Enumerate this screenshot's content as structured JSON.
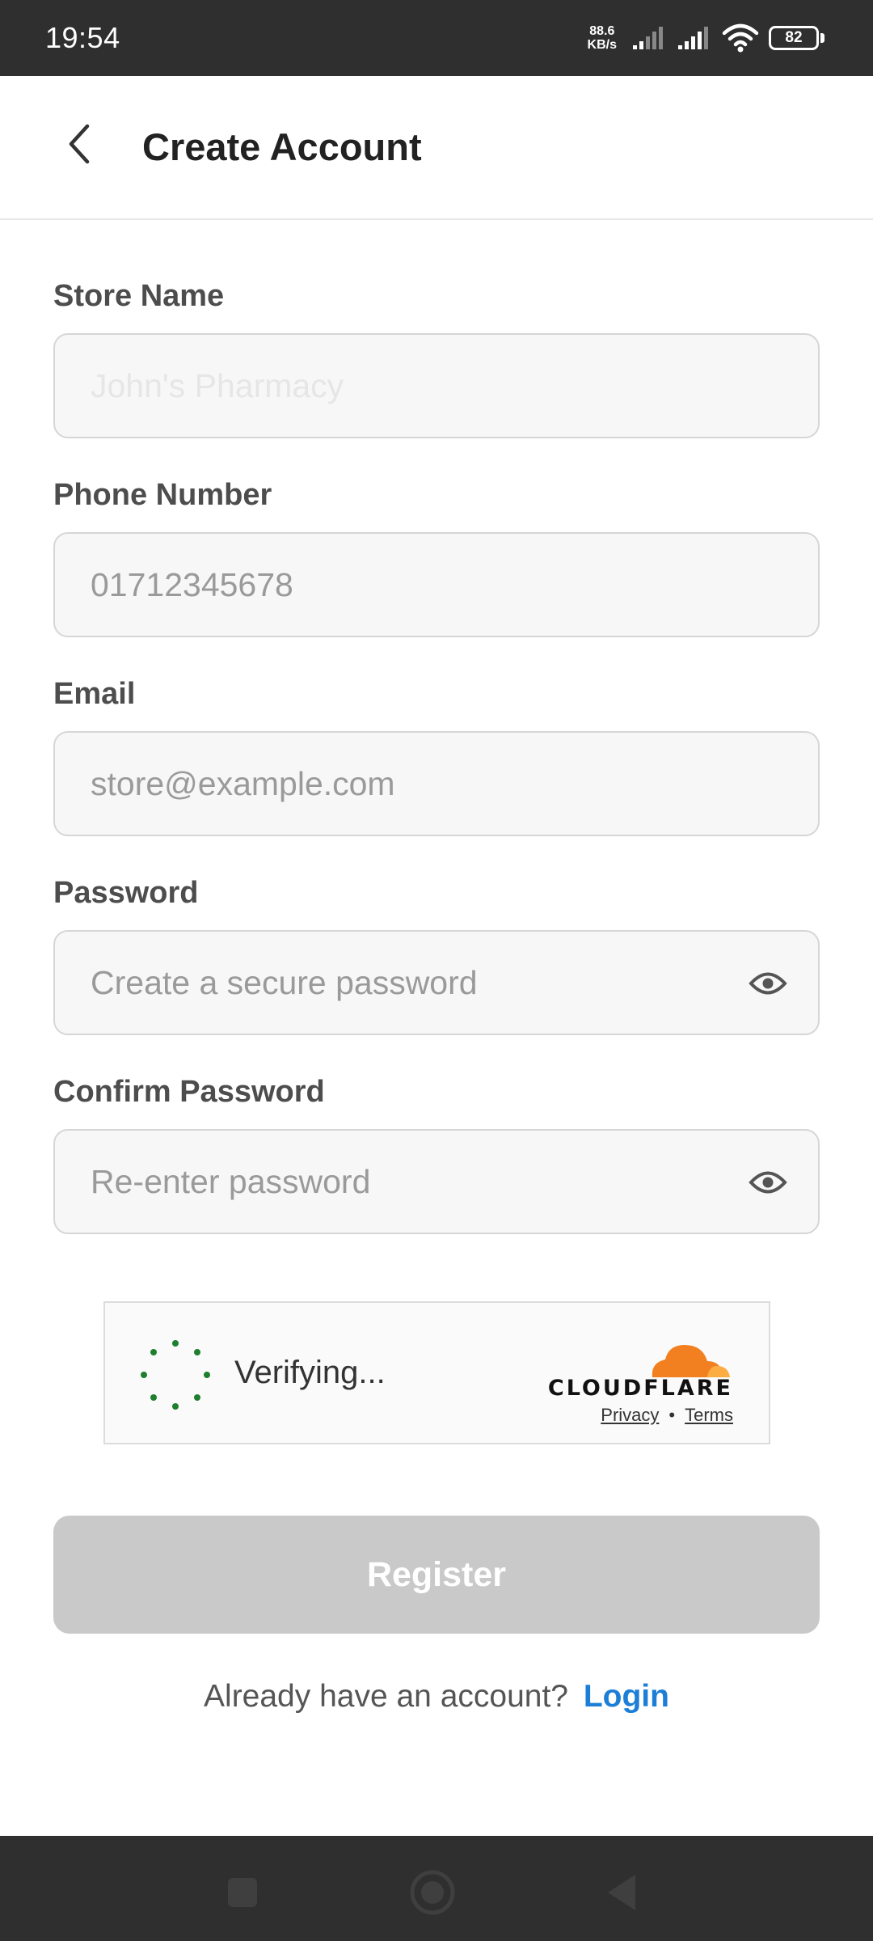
{
  "status_bar": {
    "time": "19:54",
    "net_speed_value": "88.6",
    "net_speed_unit": "KB/s",
    "battery_level": "82",
    "icons": [
      "signal-icon",
      "signal-icon",
      "wifi-icon",
      "battery-icon"
    ]
  },
  "header": {
    "title": "Create Account",
    "back_icon": "chevron-left-icon"
  },
  "form": {
    "store_name": {
      "label": "Store Name",
      "placeholder": "John's Pharmacy"
    },
    "phone": {
      "label": "Phone Number",
      "placeholder": "01712345678"
    },
    "email": {
      "label": "Email",
      "placeholder": "store@example.com"
    },
    "password": {
      "label": "Password",
      "placeholder": "Create a secure password",
      "toggle_icon": "eye-icon"
    },
    "confirm_password": {
      "label": "Confirm Password",
      "placeholder": "Re-enter password",
      "toggle_icon": "eye-icon"
    }
  },
  "captcha": {
    "status": "Verifying...",
    "brand": "CLOUDFLARE",
    "privacy_label": "Privacy",
    "separator": "•",
    "terms_label": "Terms",
    "spinner_color": "#1e7f2e",
    "brand_color": "#f38020"
  },
  "register_button": {
    "label": "Register",
    "color": "#c9c9c9"
  },
  "login_prompt": {
    "text": "Already have an account?",
    "link_label": "Login",
    "link_color": "#1c7ed6"
  },
  "nav_bar": {
    "buttons": [
      "recents-square-icon",
      "home-circle-icon",
      "back-triangle-icon"
    ]
  }
}
